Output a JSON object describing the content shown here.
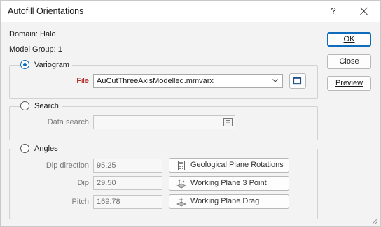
{
  "window": {
    "title": "Autofill Orientations",
    "help": "?"
  },
  "info": {
    "domain": "Domain: Halo",
    "model_group": "Model Group: 1"
  },
  "buttons": {
    "ok": "OK",
    "close": "Close",
    "preview": "Preview"
  },
  "variogram": {
    "label": "Variogram",
    "selected": true,
    "file_label": "File",
    "file_value": "AuCutThreeAxisModelled.mmvarx"
  },
  "search": {
    "label": "Search",
    "selected": false,
    "data_search_label": "Data search",
    "data_search_value": ""
  },
  "angles": {
    "label": "Angles",
    "selected": false,
    "dip_direction_label": "Dip direction",
    "dip_direction_value": "95.25",
    "dip_label": "Dip",
    "dip_value": "29.50",
    "pitch_label": "Pitch",
    "pitch_value": "169.78",
    "geological_plane_rotations": "Geological Plane Rotations",
    "working_plane_3_point": "Working Plane 3 Point",
    "working_plane_drag": "Working Plane Drag"
  },
  "colors": {
    "accent": "#0f6cbd",
    "file_label": "#b01010"
  }
}
